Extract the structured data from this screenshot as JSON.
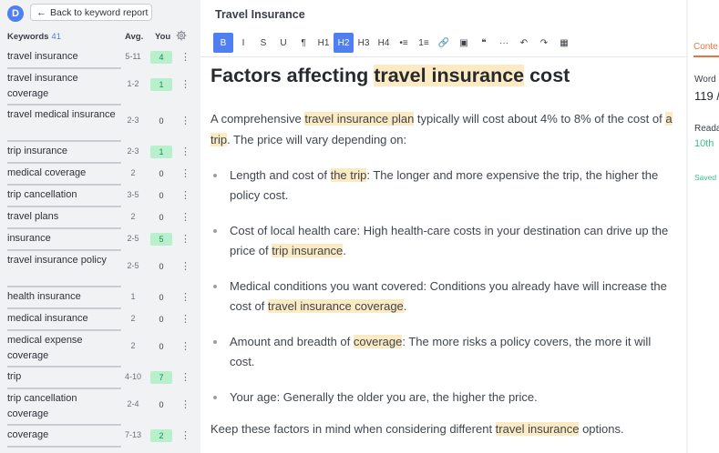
{
  "app": {
    "logo_letter": "D",
    "back_label": "Back to keyword report"
  },
  "keywords_panel": {
    "title": "Keywords",
    "count": "41",
    "avg_header": "Avg.",
    "you_header": "You",
    "rows": [
      {
        "name": "travel insurance",
        "avg": "5-11",
        "you": "4",
        "hit": true
      },
      {
        "name": "travel insurance coverage",
        "avg": "1-2",
        "you": "1",
        "hit": true
      },
      {
        "name": "travel medical insurance",
        "avg": "2-3",
        "you": "0",
        "hit": false
      },
      {
        "name": "trip insurance",
        "avg": "2-3",
        "you": "1",
        "hit": true
      },
      {
        "name": "medical coverage",
        "avg": "2",
        "you": "0",
        "hit": false
      },
      {
        "name": "trip cancellation",
        "avg": "3-5",
        "you": "0",
        "hit": false
      },
      {
        "name": "travel plans",
        "avg": "2",
        "you": "0",
        "hit": false
      },
      {
        "name": "insurance",
        "avg": "2-5",
        "you": "5",
        "hit": true
      },
      {
        "name": "travel insurance policy",
        "avg": "2-5",
        "you": "0",
        "hit": false
      },
      {
        "name": "health insurance",
        "avg": "1",
        "you": "0",
        "hit": false
      },
      {
        "name": "medical insurance",
        "avg": "2",
        "you": "0",
        "hit": false
      },
      {
        "name": "medical expense coverage",
        "avg": "2",
        "you": "0",
        "hit": false
      },
      {
        "name": "trip",
        "avg": "4-10",
        "you": "7",
        "hit": true
      },
      {
        "name": "trip cancellation coverage",
        "avg": "2-4",
        "you": "0",
        "hit": false
      },
      {
        "name": "coverage",
        "avg": "7-13",
        "you": "2",
        "hit": true
      }
    ]
  },
  "editor": {
    "doc_title": "Travel Insurance",
    "toolbar": [
      "B",
      "I",
      "S",
      "U",
      "¶",
      "H1",
      "H2",
      "H3",
      "H4",
      "•≡",
      "1≡",
      "🔗",
      "▣",
      "❝",
      "···",
      "↶",
      "↷",
      "▦"
    ],
    "heading": {
      "pre": "Factors affecting ",
      "hl": "travel insurance",
      "post": " cost"
    },
    "intro": [
      {
        "t": "A comprehensive ",
        "hl": false
      },
      {
        "t": "travel insurance plan",
        "hl": true
      },
      {
        "t": " typically will cost about 4% to 8% of the cost of ",
        "hl": false
      },
      {
        "t": "a trip",
        "hl": true
      },
      {
        "t": ". The price will vary depending on:",
        "hl": false
      }
    ],
    "bullets": [
      [
        {
          "t": "Length and cost of ",
          "hl": false
        },
        {
          "t": "the trip",
          "hl": true
        },
        {
          "t": ": The longer and more expensive the trip, the higher the policy cost.",
          "hl": false
        }
      ],
      [
        {
          "t": "Cost of local health care: High health-care costs in your destination can drive up the price of ",
          "hl": false
        },
        {
          "t": "trip insurance",
          "hl": true
        },
        {
          "t": ".",
          "hl": false
        }
      ],
      [
        {
          "t": "Medical conditions you want covered: Conditions you already have will increase the cost of ",
          "hl": false
        },
        {
          "t": "travel insurance coverage",
          "hl": true
        },
        {
          "t": ".",
          "hl": false
        }
      ],
      [
        {
          "t": "Amount and breadth of ",
          "hl": false
        },
        {
          "t": "coverage",
          "hl": true
        },
        {
          "t": ": The more risks a policy covers, the more it will cost.",
          "hl": false
        }
      ],
      [
        {
          "t": "Your age: Generally the older you are, the higher the price.",
          "hl": false
        }
      ]
    ],
    "outro": [
      {
        "t": "Keep these factors in mind when considering different ",
        "hl": false
      },
      {
        "t": "travel insurance",
        "hl": true
      },
      {
        "t": " options.",
        "hl": false
      }
    ]
  },
  "right_panel": {
    "tab_label": "Conte",
    "word_label": "Word",
    "word_value": "119 /",
    "read_label": "Reada",
    "read_value": "10th",
    "saved_label": "Saved"
  },
  "colors": {
    "accent": "#4f7ff0",
    "highlight": "#fbeac2",
    "hit_bg": "#b8efcc",
    "orange": "#e8743b",
    "green": "#3ac089"
  }
}
